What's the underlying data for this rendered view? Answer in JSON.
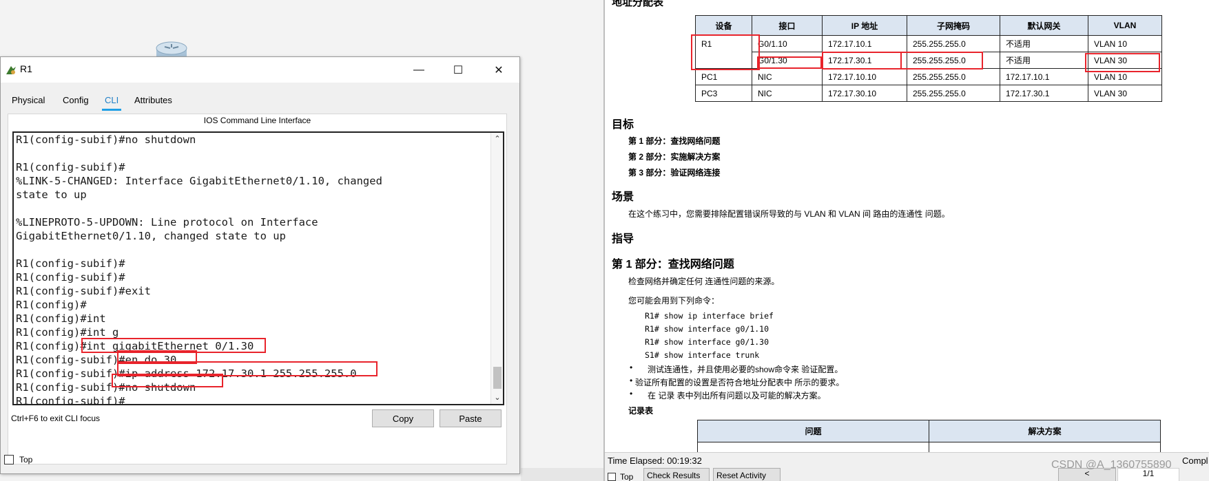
{
  "window": {
    "title": "R1",
    "minimize_glyph": "—",
    "maximize_glyph": "☐",
    "close_glyph": "✕"
  },
  "tabs": [
    "Physical",
    "Config",
    "CLI",
    "Attributes"
  ],
  "active_tab": "CLI",
  "cli": {
    "header": "IOS Command Line Interface",
    "lines": [
      "R1(config-subif)#no shutdown",
      "",
      "R1(config-subif)#",
      "%LINK-5-CHANGED: Interface GigabitEthernet0/1.10, changed",
      "state to up",
      "",
      "%LINEPROTO-5-UPDOWN: Line protocol on Interface",
      "GigabitEthernet0/1.10, changed state to up",
      "",
      "R1(config-subif)#",
      "R1(config-subif)#",
      "R1(config-subif)#exit",
      "R1(config)#",
      "R1(config)#int",
      "R1(config)#int g",
      "R1(config)#int gigabitEthernet 0/1.30",
      "R1(config-subif)#en do 30",
      "R1(config-subif)#ip address 172.17.30.1 255.255.255.0",
      "R1(config-subif)#no shutdown",
      "R1(config-subif)#"
    ],
    "focus_hint": "Ctrl+F6 to exit CLI focus",
    "copy_label": "Copy",
    "paste_label": "Paste",
    "top_label": "Top"
  },
  "instructions": {
    "table_title": "地址分配表",
    "table_headers": [
      "设备",
      "接口",
      "IP 地址",
      "子网掩码",
      "默认网关",
      "VLAN"
    ],
    "table_rows": [
      [
        "R1",
        "G0/1.10",
        "172.17.10.1",
        "255.255.255.0",
        "不适用",
        "VLAN 10"
      ],
      [
        "",
        "G0/1.30",
        "172.17.30.1",
        "255.255.255.0",
        "不适用",
        "VLAN 30"
      ],
      [
        "PC1",
        "NIC",
        "172.17.10.10",
        "255.255.255.0",
        "172.17.10.1",
        "VLAN 10"
      ],
      [
        "PC3",
        "NIC",
        "172.17.30.10",
        "255.255.255.0",
        "172.17.30.1",
        "VLAN 30"
      ]
    ],
    "goal_title": "目标",
    "goals": [
      "第 1 部分：查找网络问题",
      "第 2 部分：实施解决方案",
      "第 3 部分：验证网络连接"
    ],
    "scenario_title": "场景",
    "scenario_text": "在这个练习中，您需要排除配置错误所导致的与 VLAN 和 VLAN 间 路由的连通性 问题。",
    "guide_title": "指导",
    "part1_title": "第 1 部分：查找网络问题",
    "part1_text": "检查网络并确定任何 连通性问题的来源。",
    "commands_intro": "您可能会用到下列命令：",
    "commands": [
      "R1# show ip interface brief",
      "R1# show interface g0/1.10",
      "R1# show interface g0/1.30",
      "S1# show interface trunk"
    ],
    "bullets": [
      "测试连通性，并且使用必要的show命令来 验证配置。",
      "验证所有配置的设置是否符合地址分配表中 所示的要求。",
      "在 记录 表中列出所有问题以及可能的解决方案。"
    ],
    "record_title": "记录表",
    "record_headers": [
      "问题",
      "解决方案"
    ]
  },
  "status": {
    "elapsed": "Time Elapsed: 00:19:32",
    "top_label": "Top",
    "check_results": "Check Results",
    "reset_activity": "Reset Activity",
    "prev_label": "<",
    "page": "1/1",
    "compl": "Compl"
  },
  "watermark": "CSDN @A_1360755890",
  "colors": {
    "highlight": "#e8232b",
    "active_tab": "#1f9fe6",
    "table_header": "#dbe5f1"
  }
}
